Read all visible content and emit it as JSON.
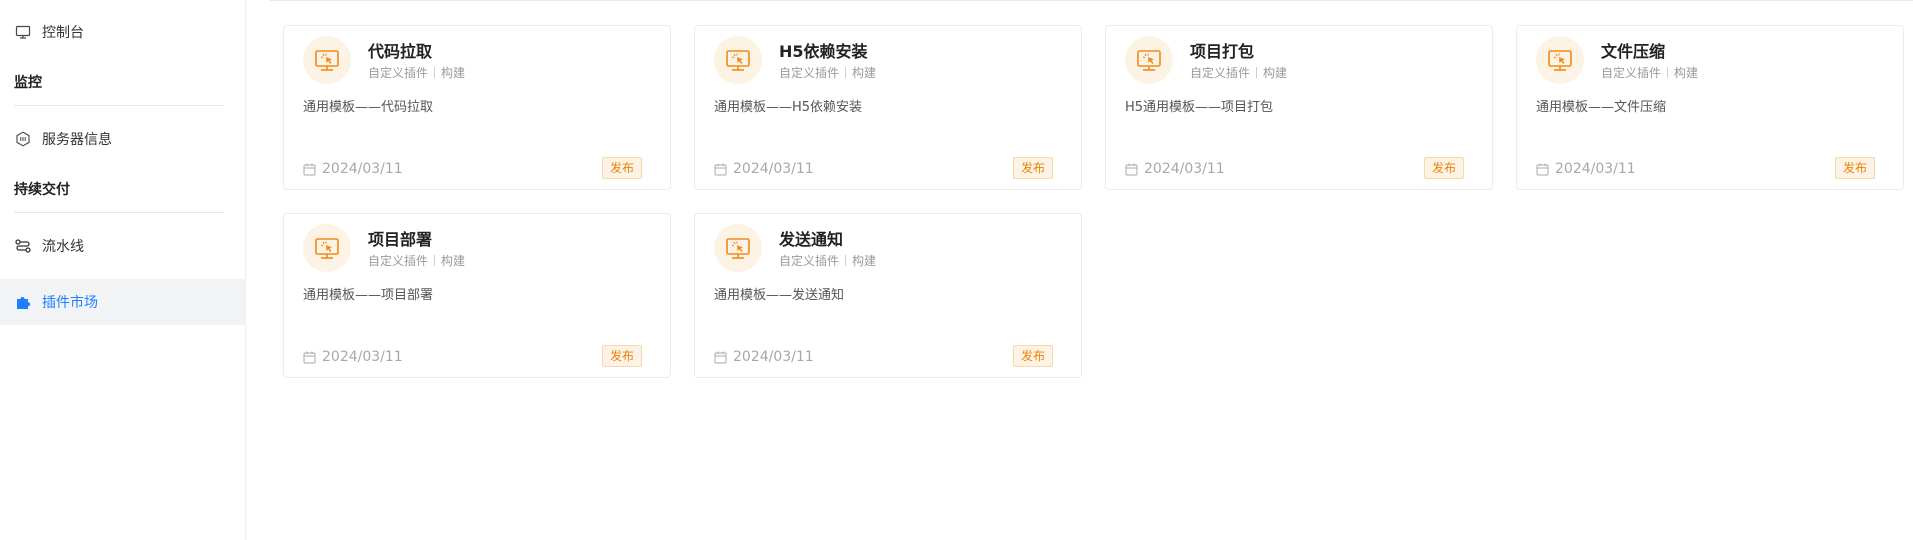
{
  "sidebar": {
    "console_label": "控制台",
    "monitor_group": "监控",
    "server_info_label": "服务器信息",
    "delivery_group": "持续交付",
    "pipeline_label": "流水线",
    "plugin_market_label": "插件市场"
  },
  "colors": {
    "accent": "#1e80ff",
    "badge_text": "#e8830f",
    "badge_bg": "#fdf3e4",
    "icon_orange": "#f08a1c"
  },
  "cards": [
    {
      "title": "代码拉取",
      "tag1": "自定义插件",
      "tag2": "构建",
      "desc": "通用模板——代码拉取",
      "date": "2024/03/11",
      "badge": "发布",
      "icon": "monitor-cursor-icon"
    },
    {
      "title": "H5依赖安装",
      "tag1": "自定义插件",
      "tag2": "构建",
      "desc": "通用模板——H5依赖安装",
      "date": "2024/03/11",
      "badge": "发布",
      "icon": "monitor-cursor-icon"
    },
    {
      "title": "项目打包",
      "tag1": "自定义插件",
      "tag2": "构建",
      "desc": "H5通用模板——项目打包",
      "date": "2024/03/11",
      "badge": "发布",
      "icon": "monitor-cursor-icon"
    },
    {
      "title": "文件压缩",
      "tag1": "自定义插件",
      "tag2": "构建",
      "desc": "通用模板——文件压缩",
      "date": "2024/03/11",
      "badge": "发布",
      "icon": "monitor-cursor-icon"
    },
    {
      "title": "项目部署",
      "tag1": "自定义插件",
      "tag2": "构建",
      "desc": "通用模板——项目部署",
      "date": "2024/03/11",
      "badge": "发布",
      "icon": "monitor-cursor-icon"
    },
    {
      "title": "发送通知",
      "tag1": "自定义插件",
      "tag2": "构建",
      "desc": "通用模板——发送通知",
      "date": "2024/03/11",
      "badge": "发布",
      "icon": "monitor-cursor-icon"
    }
  ]
}
